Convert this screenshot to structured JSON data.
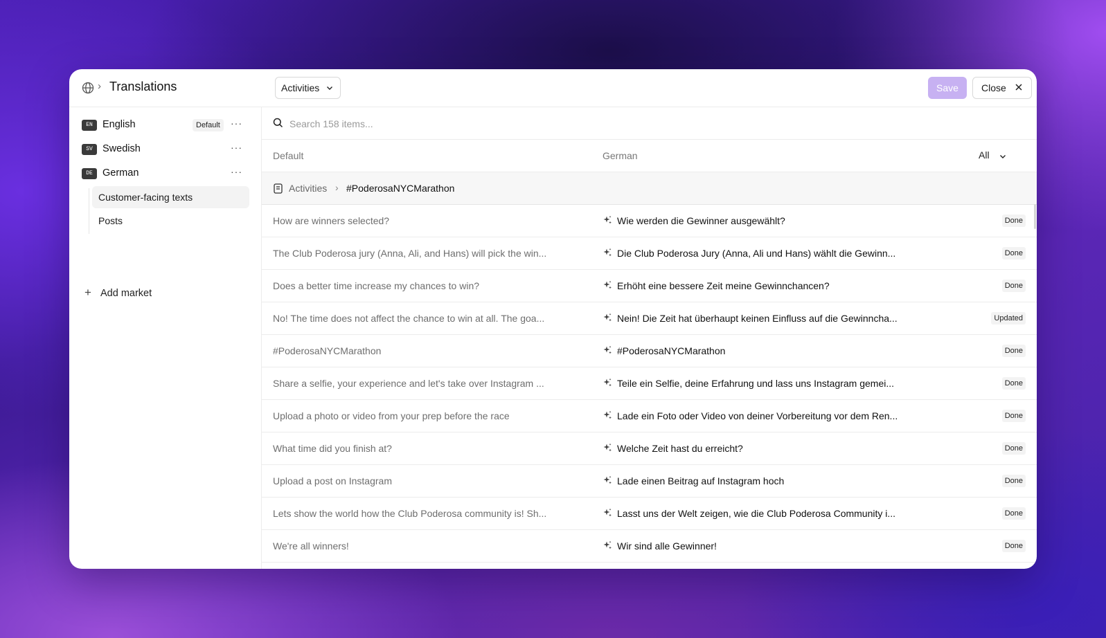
{
  "header": {
    "globe_icon": "globe-icon",
    "title": "Translations",
    "category_select": "Activities",
    "save_label": "Save",
    "close_label": "Close"
  },
  "sidebar": {
    "languages": [
      {
        "code": "EN",
        "name": "English",
        "badge": "Default",
        "more": "···"
      },
      {
        "code": "SV",
        "name": "Swedish",
        "more": "···"
      },
      {
        "code": "DE",
        "name": "German",
        "more": "···"
      }
    ],
    "sub_items": [
      {
        "label": "Customer-facing texts",
        "active": true
      },
      {
        "label": "Posts",
        "active": false
      }
    ],
    "add_market": "Add market"
  },
  "main": {
    "search_placeholder": "Search 158 items...",
    "columns": {
      "default": "Default",
      "target": "German",
      "filter": "All"
    },
    "group": {
      "parent": "Activities",
      "name": "#PoderosaNYCMarathon"
    },
    "rows": [
      {
        "source": "How are winners selected?",
        "target": "Wie werden die Gewinner ausgewählt?",
        "status": "Done"
      },
      {
        "source": "The Club Poderosa jury (Anna, Ali, and Hans) will pick the win...",
        "target": "Die Club Poderosa Jury (Anna, Ali und Hans) wählt die Gewinn...",
        "status": "Done"
      },
      {
        "source": "Does a better time increase my chances to win?",
        "target": "Erhöht eine bessere Zeit meine Gewinnchancen?",
        "status": "Done"
      },
      {
        "source": "No! The time does not affect the chance to win at all. The goa...",
        "target": "Nein! Die Zeit hat überhaupt keinen Einfluss auf die Gewinncha...",
        "status": "Updated"
      },
      {
        "source": "#PoderosaNYCMarathon",
        "target": "#PoderosaNYCMarathon",
        "status": "Done"
      },
      {
        "source": "Share a selfie, your experience and let's take over Instagram ...",
        "target": "Teile ein Selfie, deine Erfahrung und lass uns Instagram gemei...",
        "status": "Done"
      },
      {
        "source": "Upload a photo or video from your prep before the race",
        "target": "Lade ein Foto oder Video von deiner Vorbereitung vor dem Ren...",
        "status": "Done"
      },
      {
        "source": "What time did you finish at?",
        "target": "Welche Zeit hast du erreicht?",
        "status": "Done"
      },
      {
        "source": "Upload a post on Instagram",
        "target": "Lade einen Beitrag auf Instagram hoch",
        "status": "Done"
      },
      {
        "source": "Lets show the world how the Club Poderosa community is! Sh...",
        "target": "Lasst uns der Welt zeigen, wie die Club Poderosa Community i...",
        "status": "Done"
      },
      {
        "source": "We're all winners!",
        "target": "Wir sind alle Gewinner!",
        "status": "Done"
      }
    ]
  },
  "colors": {
    "accent_save": "#c7b1f2",
    "background_purple": "#4a1fb3"
  }
}
